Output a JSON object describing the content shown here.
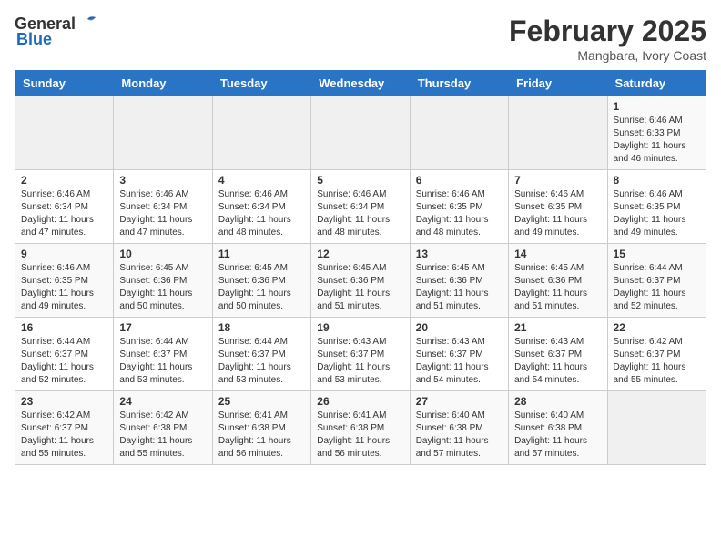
{
  "header": {
    "logo_general": "General",
    "logo_blue": "Blue",
    "month_year": "February 2025",
    "location": "Mangbara, Ivory Coast"
  },
  "calendar": {
    "days_of_week": [
      "Sunday",
      "Monday",
      "Tuesday",
      "Wednesday",
      "Thursday",
      "Friday",
      "Saturday"
    ],
    "weeks": [
      [
        {
          "day": "",
          "info": ""
        },
        {
          "day": "",
          "info": ""
        },
        {
          "day": "",
          "info": ""
        },
        {
          "day": "",
          "info": ""
        },
        {
          "day": "",
          "info": ""
        },
        {
          "day": "",
          "info": ""
        },
        {
          "day": "1",
          "info": "Sunrise: 6:46 AM\nSunset: 6:33 PM\nDaylight: 11 hours and 46 minutes."
        }
      ],
      [
        {
          "day": "2",
          "info": "Sunrise: 6:46 AM\nSunset: 6:34 PM\nDaylight: 11 hours and 47 minutes."
        },
        {
          "day": "3",
          "info": "Sunrise: 6:46 AM\nSunset: 6:34 PM\nDaylight: 11 hours and 47 minutes."
        },
        {
          "day": "4",
          "info": "Sunrise: 6:46 AM\nSunset: 6:34 PM\nDaylight: 11 hours and 48 minutes."
        },
        {
          "day": "5",
          "info": "Sunrise: 6:46 AM\nSunset: 6:34 PM\nDaylight: 11 hours and 48 minutes."
        },
        {
          "day": "6",
          "info": "Sunrise: 6:46 AM\nSunset: 6:35 PM\nDaylight: 11 hours and 48 minutes."
        },
        {
          "day": "7",
          "info": "Sunrise: 6:46 AM\nSunset: 6:35 PM\nDaylight: 11 hours and 49 minutes."
        },
        {
          "day": "8",
          "info": "Sunrise: 6:46 AM\nSunset: 6:35 PM\nDaylight: 11 hours and 49 minutes."
        }
      ],
      [
        {
          "day": "9",
          "info": "Sunrise: 6:46 AM\nSunset: 6:35 PM\nDaylight: 11 hours and 49 minutes."
        },
        {
          "day": "10",
          "info": "Sunrise: 6:45 AM\nSunset: 6:36 PM\nDaylight: 11 hours and 50 minutes."
        },
        {
          "day": "11",
          "info": "Sunrise: 6:45 AM\nSunset: 6:36 PM\nDaylight: 11 hours and 50 minutes."
        },
        {
          "day": "12",
          "info": "Sunrise: 6:45 AM\nSunset: 6:36 PM\nDaylight: 11 hours and 51 minutes."
        },
        {
          "day": "13",
          "info": "Sunrise: 6:45 AM\nSunset: 6:36 PM\nDaylight: 11 hours and 51 minutes."
        },
        {
          "day": "14",
          "info": "Sunrise: 6:45 AM\nSunset: 6:36 PM\nDaylight: 11 hours and 51 minutes."
        },
        {
          "day": "15",
          "info": "Sunrise: 6:44 AM\nSunset: 6:37 PM\nDaylight: 11 hours and 52 minutes."
        }
      ],
      [
        {
          "day": "16",
          "info": "Sunrise: 6:44 AM\nSunset: 6:37 PM\nDaylight: 11 hours and 52 minutes."
        },
        {
          "day": "17",
          "info": "Sunrise: 6:44 AM\nSunset: 6:37 PM\nDaylight: 11 hours and 53 minutes."
        },
        {
          "day": "18",
          "info": "Sunrise: 6:44 AM\nSunset: 6:37 PM\nDaylight: 11 hours and 53 minutes."
        },
        {
          "day": "19",
          "info": "Sunrise: 6:43 AM\nSunset: 6:37 PM\nDaylight: 11 hours and 53 minutes."
        },
        {
          "day": "20",
          "info": "Sunrise: 6:43 AM\nSunset: 6:37 PM\nDaylight: 11 hours and 54 minutes."
        },
        {
          "day": "21",
          "info": "Sunrise: 6:43 AM\nSunset: 6:37 PM\nDaylight: 11 hours and 54 minutes."
        },
        {
          "day": "22",
          "info": "Sunrise: 6:42 AM\nSunset: 6:37 PM\nDaylight: 11 hours and 55 minutes."
        }
      ],
      [
        {
          "day": "23",
          "info": "Sunrise: 6:42 AM\nSunset: 6:37 PM\nDaylight: 11 hours and 55 minutes."
        },
        {
          "day": "24",
          "info": "Sunrise: 6:42 AM\nSunset: 6:38 PM\nDaylight: 11 hours and 55 minutes."
        },
        {
          "day": "25",
          "info": "Sunrise: 6:41 AM\nSunset: 6:38 PM\nDaylight: 11 hours and 56 minutes."
        },
        {
          "day": "26",
          "info": "Sunrise: 6:41 AM\nSunset: 6:38 PM\nDaylight: 11 hours and 56 minutes."
        },
        {
          "day": "27",
          "info": "Sunrise: 6:40 AM\nSunset: 6:38 PM\nDaylight: 11 hours and 57 minutes."
        },
        {
          "day": "28",
          "info": "Sunrise: 6:40 AM\nSunset: 6:38 PM\nDaylight: 11 hours and 57 minutes."
        },
        {
          "day": "",
          "info": ""
        }
      ]
    ]
  }
}
